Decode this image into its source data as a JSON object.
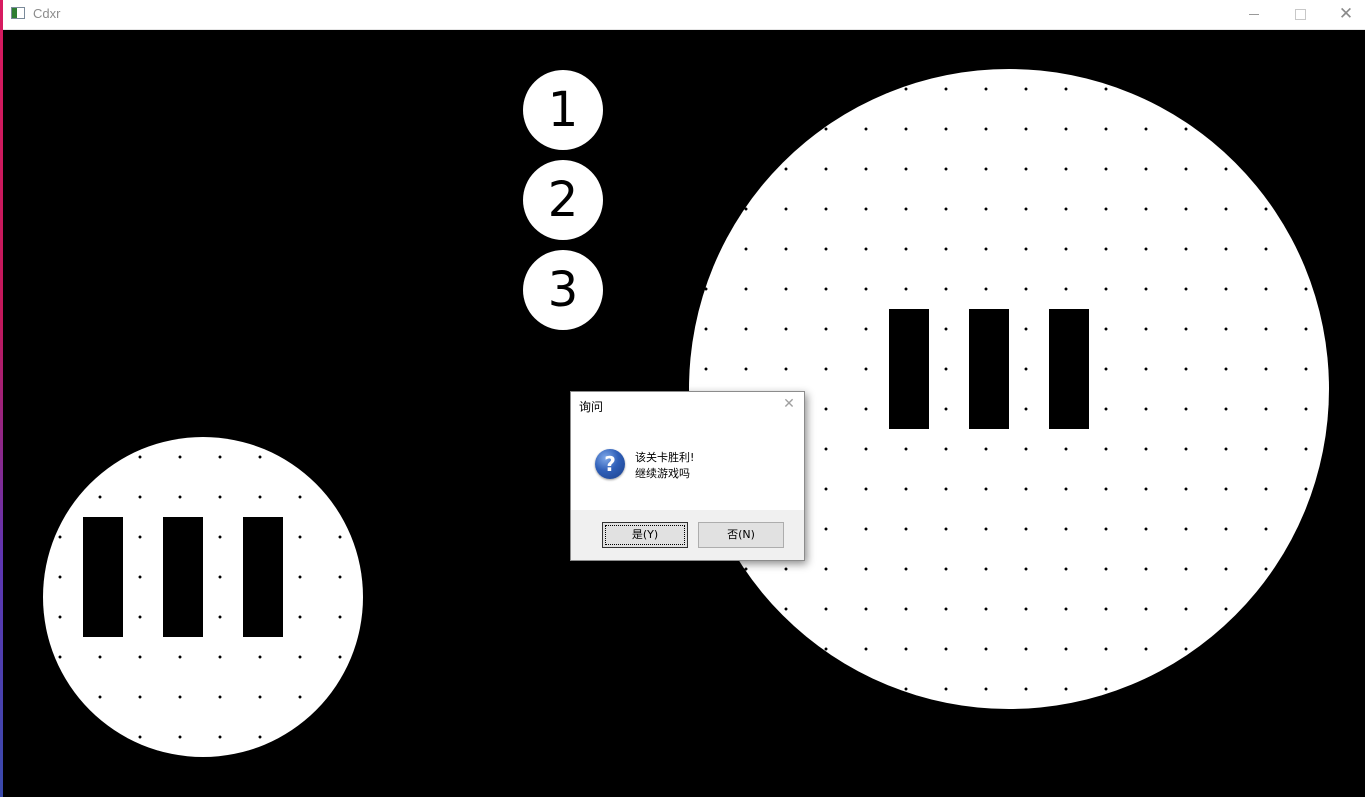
{
  "window": {
    "title": "Cdxr",
    "minimize_icon": "minimize-icon",
    "maximize_icon": "maximize-icon",
    "close_icon": "close-icon",
    "close_glyph": "✕"
  },
  "level_buttons": [
    {
      "label": "1"
    },
    {
      "label": "2"
    },
    {
      "label": "3"
    }
  ],
  "dialog": {
    "title": "询问",
    "close_glyph": "✕",
    "icon": "question-icon",
    "icon_glyph": "?",
    "message_line1": "该关卡胜利!",
    "message_line2": "继续游戏吗",
    "yes_label": "是(Y)",
    "no_label": "否(N)"
  },
  "colors": {
    "background": "#000000",
    "board": "#ffffff",
    "accent_left": "#d81b60"
  }
}
